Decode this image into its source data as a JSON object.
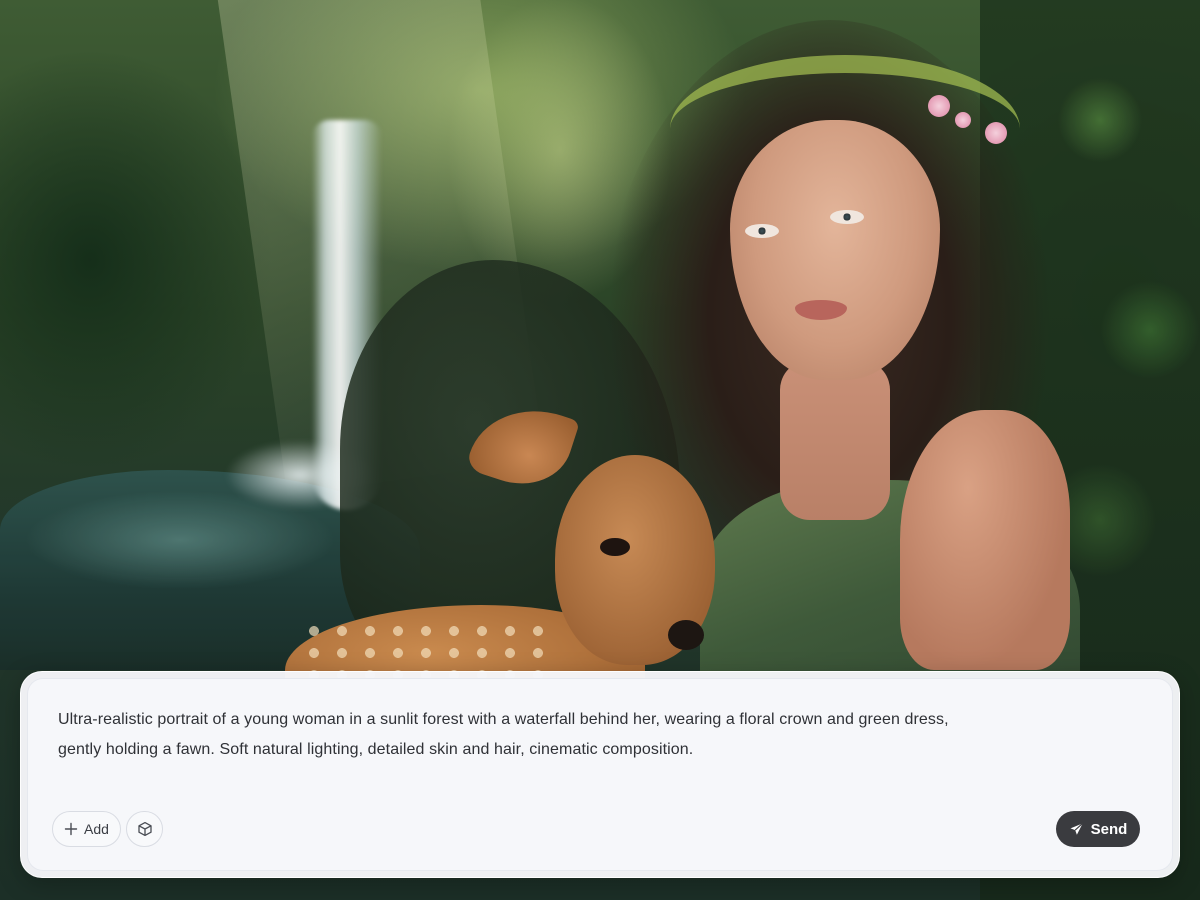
{
  "background": {
    "description_icon": "generated-image-preview",
    "accent_colors": {
      "foliage": "#2b4427",
      "skin": "#cf9a7e",
      "fawn": "#a86a36",
      "dress": "#3f5a3a"
    }
  },
  "composer": {
    "prompt_line_1": "Ultra-realistic portrait of a young woman in a sunlit forest with a waterfall behind her, wearing a floral crown and green dress,",
    "prompt_line_2": "gently holding a fawn. Soft natural lighting, detailed skin and hair, cinematic composition.",
    "add_label": "Add",
    "add_icon": "plus-icon",
    "model_icon": "cube-icon",
    "send_label": "Send",
    "send_icon": "paper-plane-icon",
    "colors": {
      "panel": "#f6f7fa",
      "send_button": "#3a3b3f",
      "text": "#2f3136"
    }
  }
}
